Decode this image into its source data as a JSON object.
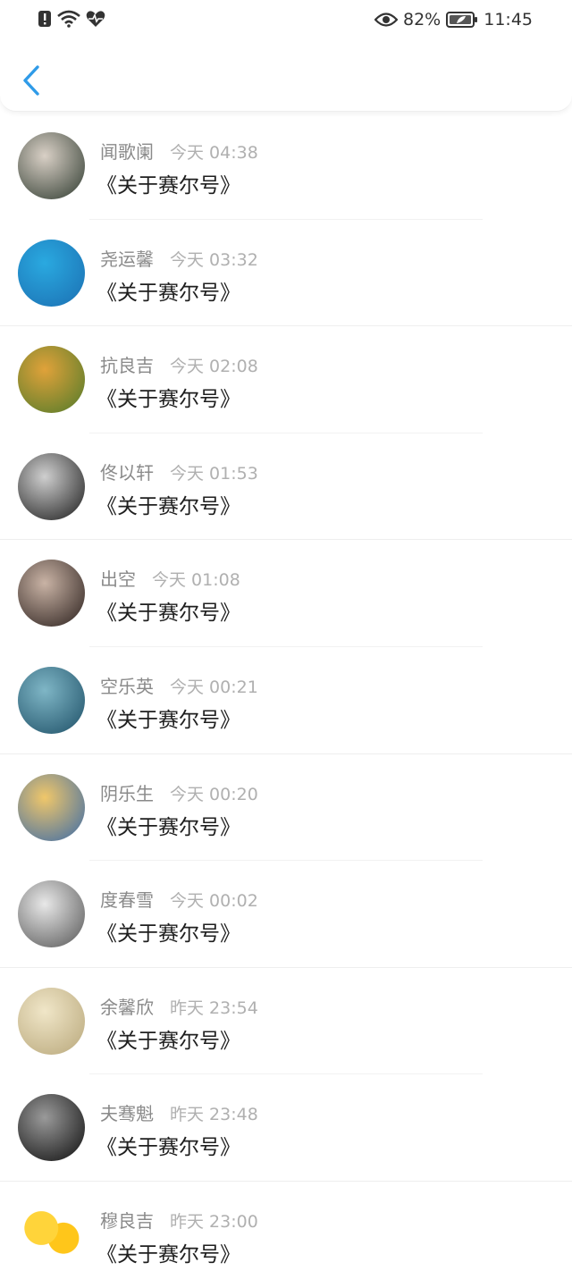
{
  "status_bar": {
    "battery": "82%",
    "time": "11:45",
    "icons": [
      "alert-icon",
      "wifi-icon",
      "heartbeat-icon",
      "eye-icon",
      "battery-icon"
    ]
  },
  "nav": {
    "back_icon": "chevron-left-icon",
    "accent": "#2f9be8"
  },
  "messages": [
    {
      "sender": "闻歌阑",
      "time": "今天 04:38",
      "title": "《关于赛尔号》",
      "avatar": "anime-boy",
      "bg1": "#d9d0c6",
      "bg2": "#2e3a2f"
    },
    {
      "sender": "尧运馨",
      "time": "今天 03:32",
      "title": "《关于赛尔号》",
      "avatar": "cartoon-blue",
      "bg1": "#2aa9e0",
      "bg2": "#1b6fb2"
    },
    {
      "sender": "抗良吉",
      "time": "今天 02:08",
      "title": "《关于赛尔号》",
      "avatar": "autumn-leaves",
      "bg1": "#e0a23a",
      "bg2": "#4f7a2a"
    },
    {
      "sender": "佟以轩",
      "time": "今天 01:53",
      "title": "《关于赛尔号》",
      "avatar": "bw-duo",
      "bg1": "#cfcfcf",
      "bg2": "#1a1a1a"
    },
    {
      "sender": "出空",
      "time": "今天 01:08",
      "title": "《关于赛尔号》",
      "avatar": "girl-guitar",
      "bg1": "#c9b3a5",
      "bg2": "#2a1f1c"
    },
    {
      "sender": "空乐英",
      "time": "今天 00:21",
      "title": "《关于赛尔号》",
      "avatar": "sea-couple",
      "bg1": "#7fb6c6",
      "bg2": "#1d4f66"
    },
    {
      "sender": "阴乐生",
      "time": "今天 00:20",
      "title": "《关于赛尔号》",
      "avatar": "anime-girl",
      "bg1": "#f0c76a",
      "bg2": "#3a6aa8"
    },
    {
      "sender": "度春雪",
      "time": "今天 00:02",
      "title": "《关于赛尔号》",
      "avatar": "mono-girl",
      "bg1": "#e8e8e8",
      "bg2": "#555555"
    },
    {
      "sender": "余馨欣",
      "time": "昨天 23:54",
      "title": "《关于赛尔号》",
      "avatar": "sunlight-girl",
      "bg1": "#f0e6c8",
      "bg2": "#b8a77a"
    },
    {
      "sender": "夫骞魁",
      "time": "昨天 23:48",
      "title": "《关于赛尔号》",
      "avatar": "dark-face",
      "bg1": "#9a9a9a",
      "bg2": "#0d0d0d"
    },
    {
      "sender": "穆良吉",
      "time": "昨天 23:00",
      "title": "《关于赛尔号》",
      "avatar": "cartoon-chicks",
      "bg1": "#ffd43a",
      "bg2": "#ffffff"
    }
  ]
}
